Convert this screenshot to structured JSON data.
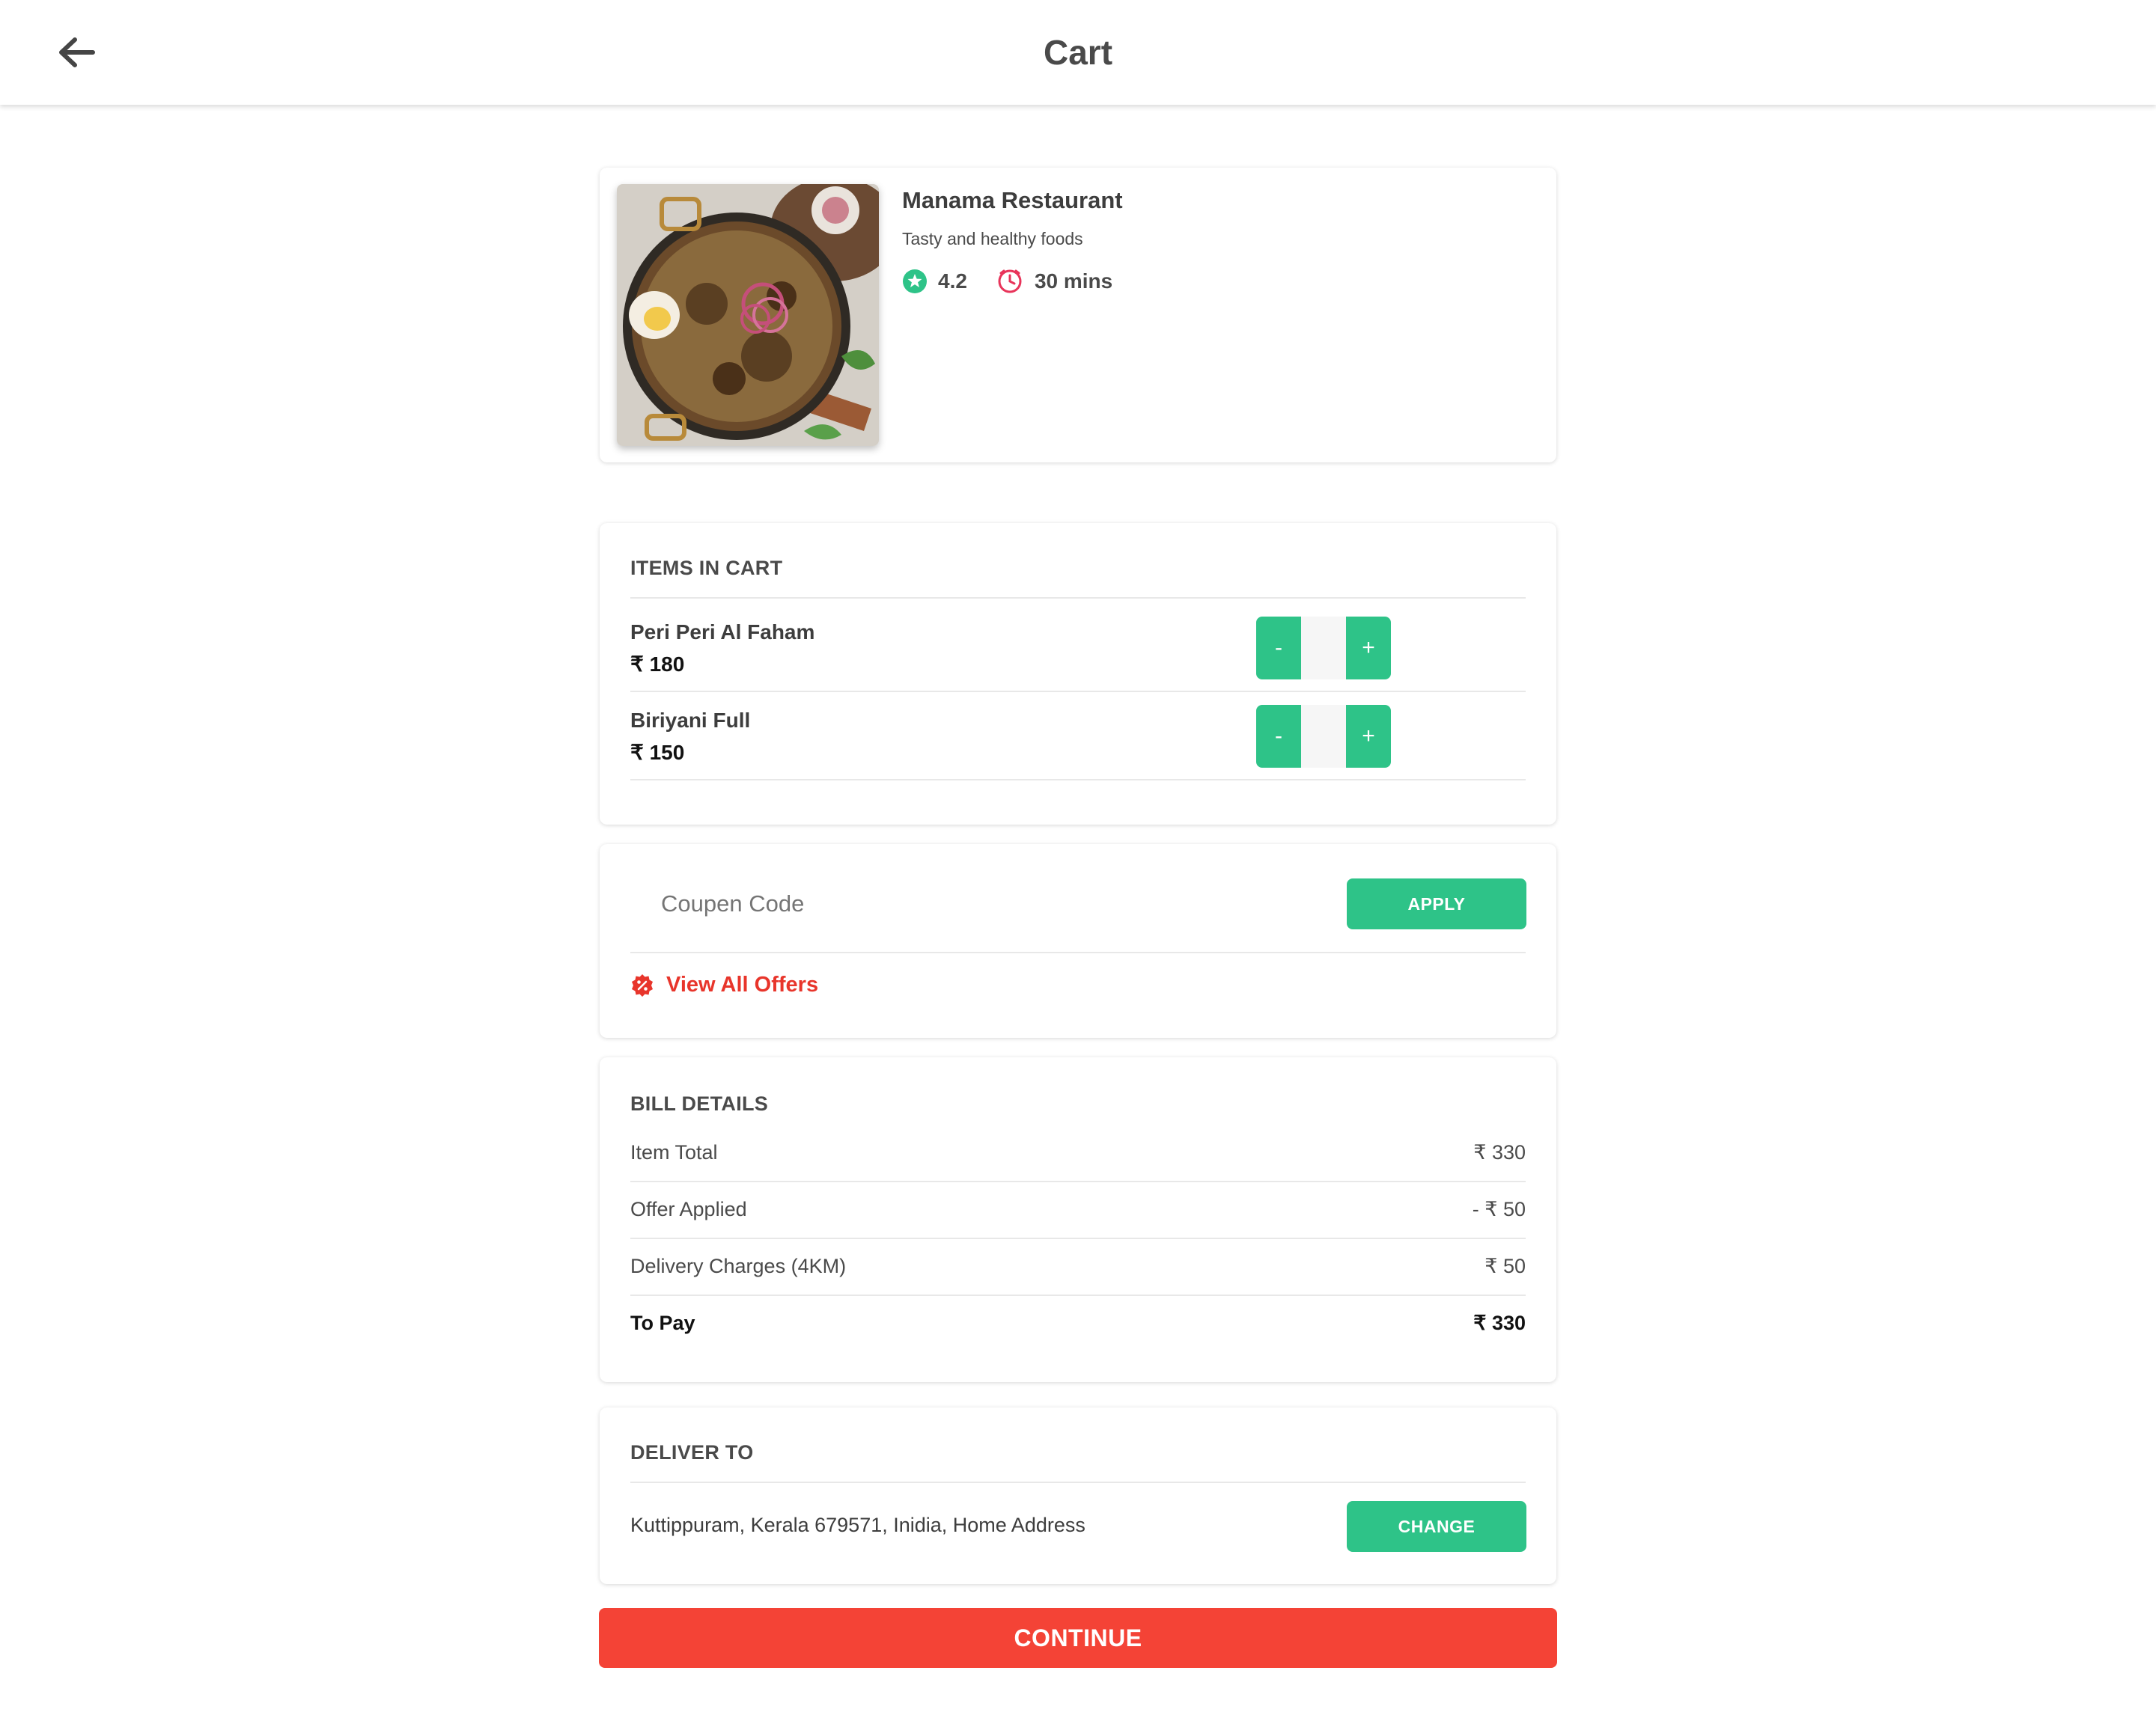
{
  "header": {
    "title": "Cart",
    "back_icon": "arrow-left-icon"
  },
  "restaurant": {
    "name": "Manama Restaurant",
    "tagline": "Tasty and healthy foods",
    "rating": "4.2",
    "time": "30 mins",
    "rating_icon": "star-icon",
    "time_icon": "clock-icon",
    "rating_color": "#2ec388",
    "time_color": "#e8345a"
  },
  "cart": {
    "title": "ITEMS IN CART",
    "items": [
      {
        "name": "Peri Peri Al Faham",
        "price": "₹ 180",
        "minus": "-",
        "plus": "+",
        "qty": ""
      },
      {
        "name": "Biriyani Full",
        "price": "₹ 150",
        "minus": "-",
        "plus": "+",
        "qty": ""
      }
    ]
  },
  "coupon": {
    "placeholder": "Coupen Code",
    "apply_label": "APPLY",
    "offers_label": "View All Offers",
    "offers_icon": "discount-badge-icon",
    "offers_color": "#e8352b"
  },
  "bill": {
    "title": "BILL DETAILS",
    "rows": [
      {
        "label": "Item Total",
        "value": "₹ 330"
      },
      {
        "label": "Offer Applied",
        "value": "- ₹ 50"
      },
      {
        "label": "Delivery Charges (4KM)",
        "value": "₹ 50"
      }
    ],
    "total_label": "To Pay",
    "total_value": "₹ 330"
  },
  "delivery": {
    "title": "DELIVER TO",
    "address": "Kuttippuram, Kerala 679571, Inidia, Home Address",
    "change_label": "CHANGE"
  },
  "continue_label": "CONTINUE",
  "colors": {
    "accent_green": "#2ec388",
    "accent_red": "#f44336"
  }
}
